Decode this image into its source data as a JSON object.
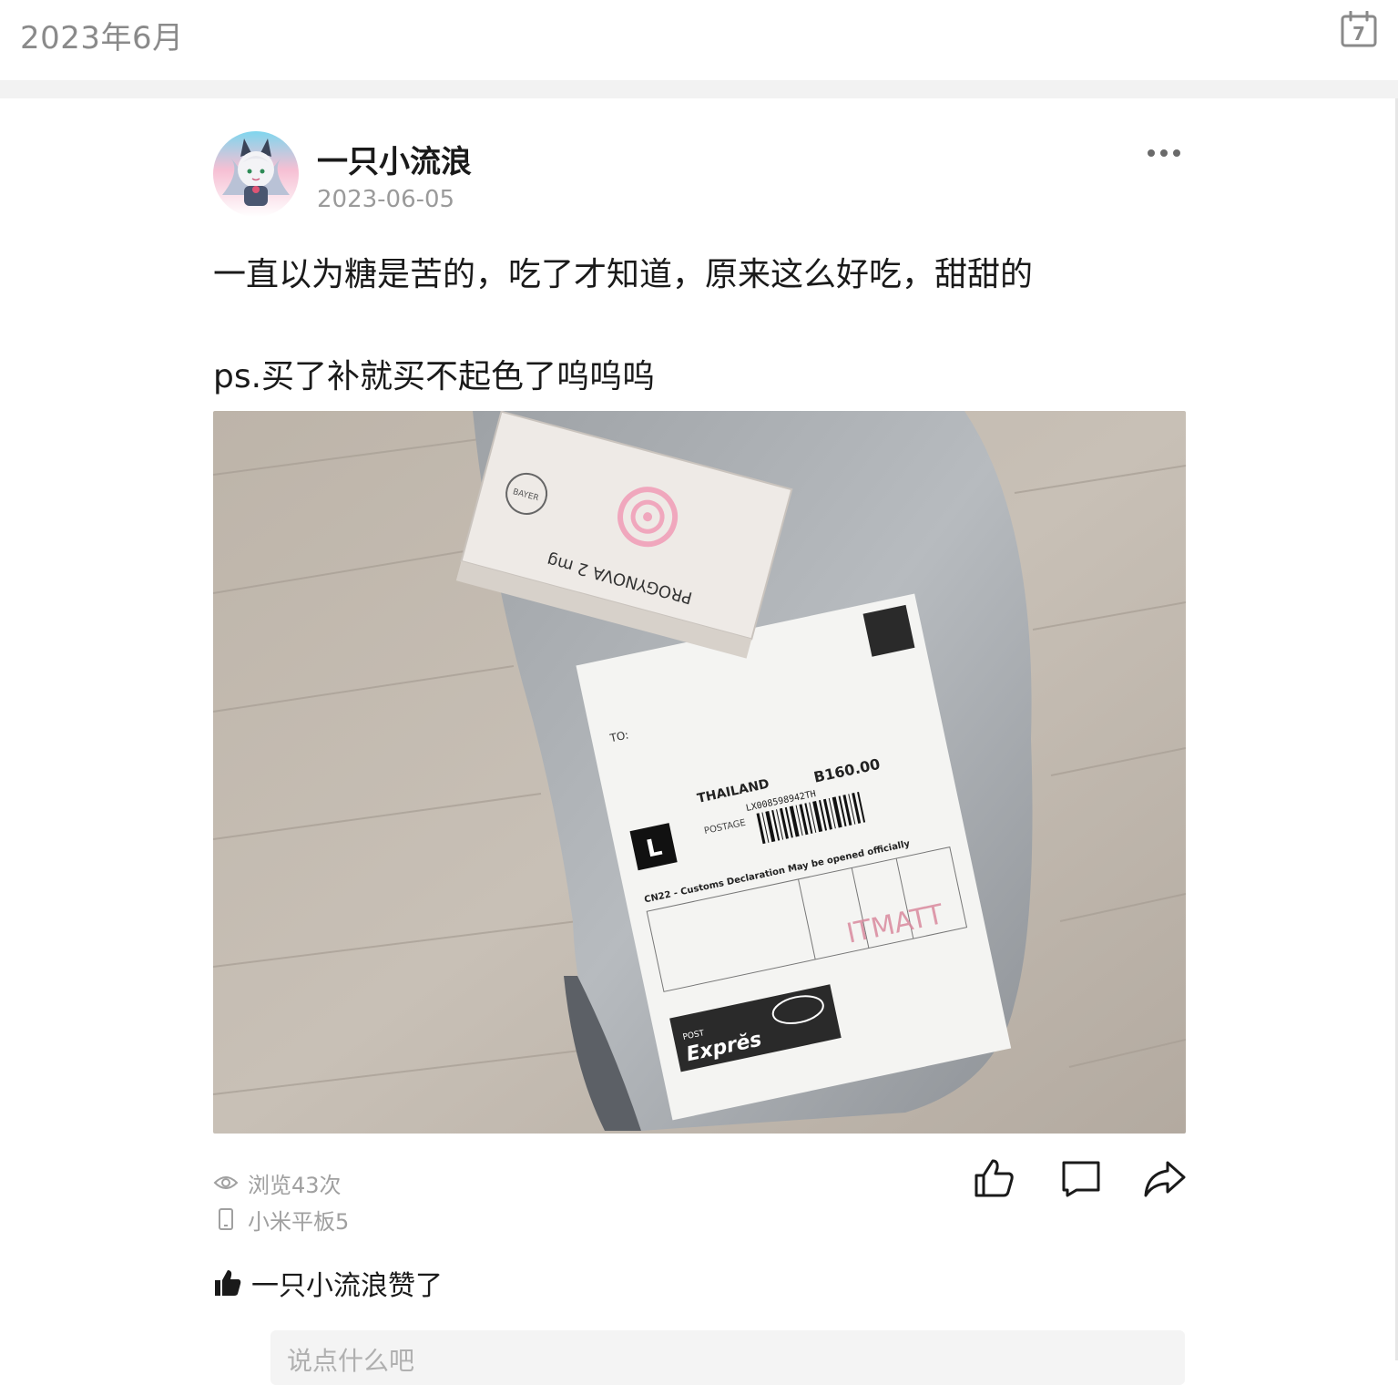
{
  "header": {
    "month_title": "2023年6月",
    "calendar_day": "7"
  },
  "post": {
    "author": "一只小流浪",
    "date": "2023-06-05",
    "text_line1": "一直以为糖是苦的，吃了才知道，原来这么好吃，甜甜的",
    "text_line2": "ps.买了补就买不起色了呜呜呜",
    "photo": {
      "box_text": "PROGYNOVA 2 mg",
      "brand": "BAYER",
      "label_to": "TO:",
      "label_country": "THAILAND",
      "label_postage": "POSTAGE",
      "label_amount": "B160.00",
      "label_tracking": "LX008598942TH",
      "label_size": "L",
      "label_customs": "CN22 - Customs Declaration  May be opened officially",
      "label_logo": "Exprĕs",
      "label_logo_top": "POST",
      "label_handwritten": "ITMATT"
    }
  },
  "meta": {
    "views": "浏览43次",
    "device": "小米平板5"
  },
  "likes": {
    "text": "一只小流浪赞了"
  },
  "comment": {
    "placeholder": "说点什么吧"
  },
  "colors": {
    "muted": "#9a9a9a",
    "text": "#1a1a1a",
    "band": "#f2f2f2"
  }
}
